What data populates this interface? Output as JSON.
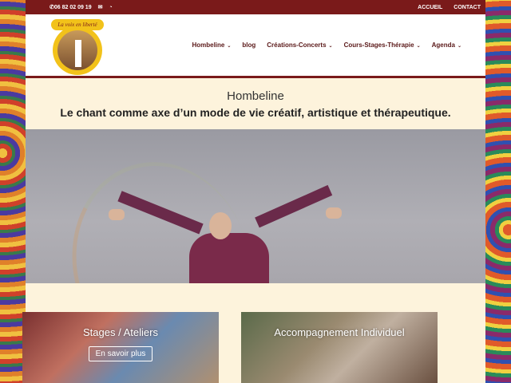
{
  "topbar": {
    "phone": "06 82 02 09 19",
    "links": [
      "ACCUEIL",
      "CONTACT"
    ]
  },
  "logo": {
    "text": "La voix en liberté"
  },
  "nav": {
    "items": [
      {
        "label": "Hombeline",
        "dropdown": true
      },
      {
        "label": "blog",
        "dropdown": false
      },
      {
        "label": "Créations-Concerts",
        "dropdown": true
      },
      {
        "label": "Cours-Stages-Thérapie",
        "dropdown": true
      },
      {
        "label": "Agenda",
        "dropdown": true
      }
    ]
  },
  "hero": {
    "name": "Hombeline",
    "tagline": "Le chant comme axe d’un mode de vie créatif, artistique et thérapeutique."
  },
  "cards": [
    {
      "title": "Stages / Ateliers",
      "button": "En savoir plus"
    },
    {
      "title": "Accompagnement Individuel",
      "button": ""
    }
  ],
  "colors": {
    "brand": "#7a1a1a",
    "background": "#fdf3dc",
    "logo_yellow": "#f2c21a"
  }
}
